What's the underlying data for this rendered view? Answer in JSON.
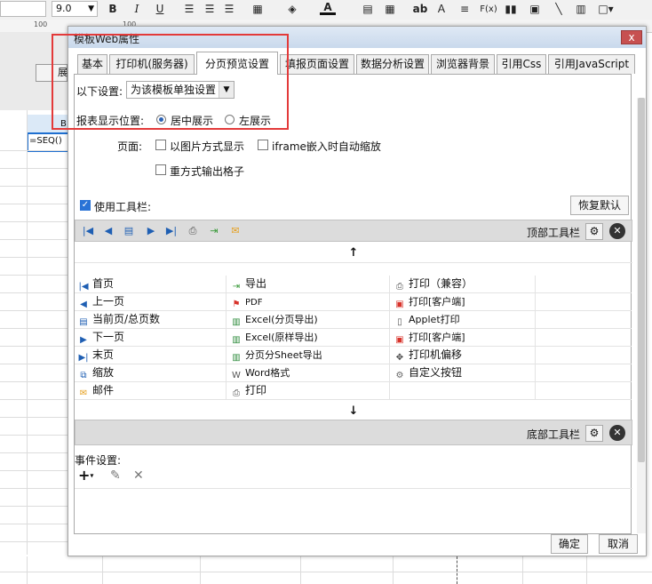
{
  "toolbar": {
    "font_size": "9.0",
    "icons": [
      "bold-icon",
      "italic-icon",
      "underline-icon",
      "align-left-icon",
      "align-center-icon",
      "align-right-icon",
      "border-icon",
      "fill-color-icon",
      "font-color-icon",
      "merge-icon",
      "split-icon",
      "text-ab-icon",
      "text-format-icon",
      "formula-icon",
      "chart-icon",
      "image-icon",
      "line-icon",
      "frame-icon",
      "more-icon"
    ],
    "bold": "B",
    "italic": "I",
    "underline": "U",
    "text_icon": "ab",
    "formula": "F(x)"
  },
  "ruler": {
    "mark1": "100",
    "mark2": "100"
  },
  "sheet": {
    "button_label": "展",
    "col_header": "B",
    "cell_text": "=SEQ()"
  },
  "dialog": {
    "title": "模板Web属性",
    "close": "x",
    "tabs": [
      {
        "label": "基本"
      },
      {
        "label": "打印机(服务器)"
      },
      {
        "label": "分页预览设置"
      },
      {
        "label": "填报页面设置"
      },
      {
        "label": "数据分析设置"
      },
      {
        "label": "浏览器背景"
      },
      {
        "label": "引用Css"
      },
      {
        "label": "引用JavaScript"
      }
    ],
    "settings_label": "以下设置:",
    "settings_value": "为该模板单独设置",
    "position_label": "报表显示位置:",
    "radio_center": "居中展示",
    "radio_left": "左展示",
    "page_label": "页面:",
    "check_image": "以图片方式显示",
    "check_iframe": "iframe嵌入时自动缩放",
    "check_repeat": "重方式输出格子",
    "use_toolbar": "使用工具栏:",
    "restore_default": "恢复默认",
    "top_toolbar": "顶部工具栏",
    "bottom_toolbar": "底部工具栏",
    "up_arrow": "↑",
    "down_arrow": "↓",
    "items": [
      [
        "首页",
        "导出",
        "打印（兼容）"
      ],
      [
        "上一页",
        "PDF",
        "打印[客户端]"
      ],
      [
        "当前页/总页数",
        "Excel(分页导出)",
        "Applet打印"
      ],
      [
        "下一页",
        "Excel(原样导出)",
        "打印[客户端]"
      ],
      [
        "末页",
        "分页分Sheet导出",
        "打印机偏移"
      ],
      [
        "缩放",
        "Word格式",
        "自定义按钮"
      ],
      [
        "邮件",
        "打印",
        ""
      ]
    ],
    "item_icons": [
      [
        "first-page-icon",
        "export-icon",
        "printer-icon"
      ],
      [
        "prev-page-icon",
        "pdf-icon",
        "pdf-print-icon"
      ],
      [
        "page-count-icon",
        "excel-icon",
        "applet-print-icon"
      ],
      [
        "next-page-icon",
        "excel-icon",
        "pdf-print-icon"
      ],
      [
        "last-page-icon",
        "excel-icon",
        "printer-offset-icon"
      ],
      [
        "zoom-icon",
        "word-icon",
        "gear-icon"
      ],
      [
        "mail-icon",
        "printer-icon",
        ""
      ]
    ],
    "event_label": "事件设置:",
    "ok": "确定",
    "cancel": "取消"
  },
  "colors": {
    "accent": "#2a73d6",
    "highlight": "#e33a3a"
  }
}
